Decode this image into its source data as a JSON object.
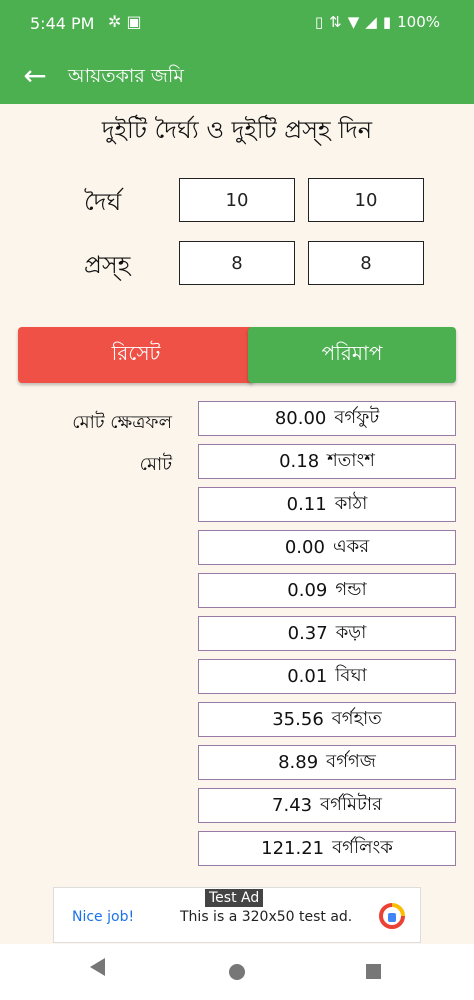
{
  "status": {
    "time": "5:44 PM",
    "battery": "100%"
  },
  "appbar": {
    "title": "আয়তকার জমি"
  },
  "heading": "দুইটি দৈর্ঘ্য ও দুইটি প্রস্হ দিন",
  "length": {
    "label": "দৈর্ঘ",
    "value1": "10",
    "value2": "10"
  },
  "width": {
    "label": "প্রস্হ",
    "value1": "8",
    "value2": "8"
  },
  "buttons": {
    "reset": "রিসেট",
    "measure": "পরিমাপ"
  },
  "results_labels": {
    "total_area": "মোট ক্ষেত্রফল",
    "total": "মোট"
  },
  "results": [
    {
      "value": "80.00",
      "unit": "বর্গফুট"
    },
    {
      "value": "0.18",
      "unit": "শতাংশ"
    },
    {
      "value": "0.11",
      "unit": "কাঠা"
    },
    {
      "value": "0.00",
      "unit": "একর"
    },
    {
      "value": "0.09",
      "unit": "গন্ডা"
    },
    {
      "value": "0.37",
      "unit": "কড়া"
    },
    {
      "value": "0.01",
      "unit": "বিঘা"
    },
    {
      "value": "35.56",
      "unit": "বর্গহাত"
    },
    {
      "value": "8.89",
      "unit": "বর্গগজ"
    },
    {
      "value": "7.43",
      "unit": "বর্গমিটার"
    },
    {
      "value": "121.21",
      "unit": "বর্গলিংক"
    }
  ],
  "ad": {
    "tag": "Test Ad",
    "nice": "Nice job!",
    "text": "This is a 320x50 test ad."
  },
  "colors": {
    "primary": "#4caf50",
    "reset": "#ef5146",
    "background": "#fbf5ec"
  }
}
